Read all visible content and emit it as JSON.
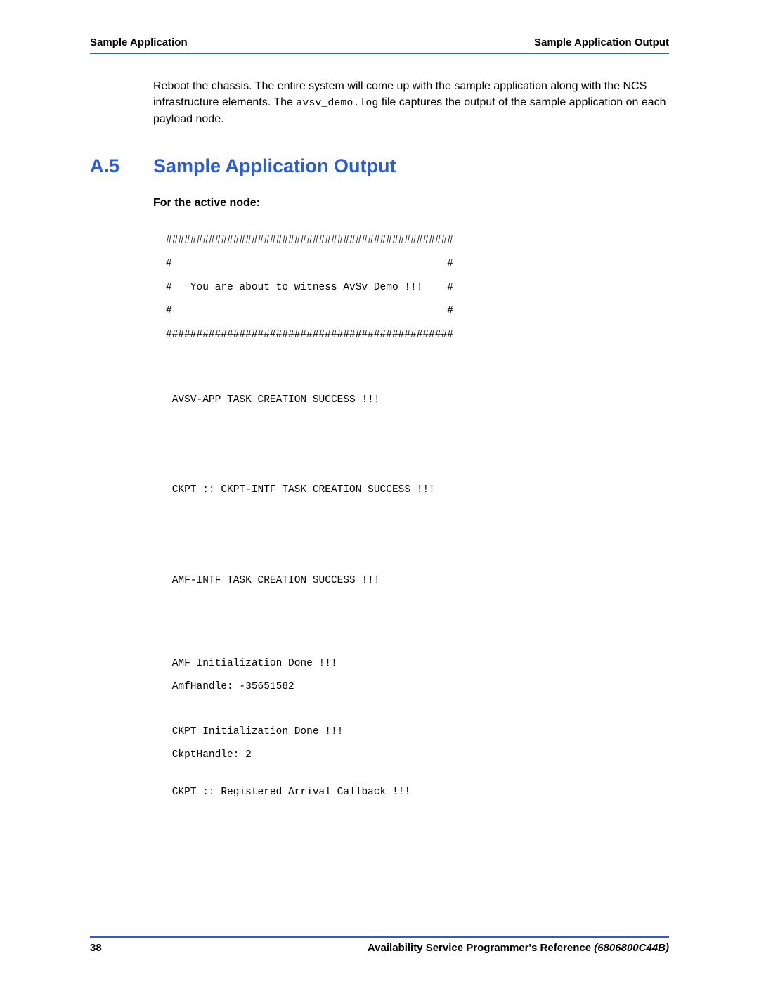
{
  "header": {
    "left": "Sample Application",
    "right": "Sample Application Output"
  },
  "intro": {
    "part1": "Reboot the chassis. The entire system will come up with the sample application along with the NCS infrastructure elements. The ",
    "code": "avsv_demo.log",
    "part2": " file captures the output of the sample application on each payload node."
  },
  "section": {
    "number": "A.5",
    "title": "Sample Application Output"
  },
  "subhead": "For the active node:",
  "code": {
    "banner1": "###############################################",
    "banner2": "#                                             #",
    "banner3": "#   You are about to witness AvSv Demo !!!    #",
    "banner4": "#                                             #",
    "banner5": "###############################################",
    "l1": " AVSV-APP TASK CREATION SUCCESS !!!",
    "l2": " CKPT :: CKPT-INTF TASK CREATION SUCCESS !!!",
    "l3": " AMF-INTF TASK CREATION SUCCESS !!!",
    "l4": " AMF Initialization Done !!! ",
    "l5": " AmfHandle: -35651582 ",
    "l6": " CKPT Initialization Done !!!",
    "l7": " CkptHandle: 2 ",
    "l8": " CKPT :: Registered Arrival Callback !!!"
  },
  "footer": {
    "page": "38",
    "ref_title": "Availability Service Programmer's Reference ",
    "docnum": "(6806800C44B)"
  }
}
